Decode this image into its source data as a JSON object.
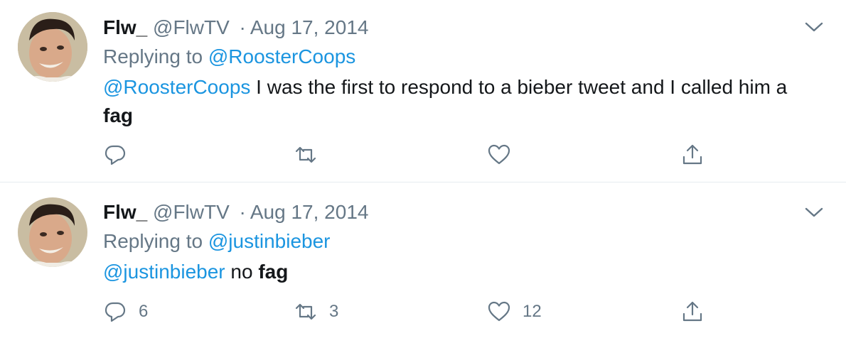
{
  "tweets": [
    {
      "display_name": "Flw_",
      "handle": "@FlwTV",
      "separator": "·",
      "date": "Aug 17, 2014",
      "replying_prefix": "Replying to",
      "replying_to": "@RoosterCoops",
      "text_mention": "@RoosterCoops",
      "text_body": " I was the first to respond to a bieber tweet and I called him a ",
      "text_bold": "fag",
      "counts": {
        "reply": "",
        "retweet": "",
        "like": ""
      }
    },
    {
      "display_name": "Flw_",
      "handle": "@FlwTV",
      "separator": "·",
      "date": "Aug 17, 2014",
      "replying_prefix": "Replying to",
      "replying_to": "@justinbieber",
      "text_mention": "@justinbieber",
      "text_body": " no ",
      "text_bold": "fag",
      "counts": {
        "reply": "6",
        "retweet": "3",
        "like": "12"
      }
    }
  ],
  "icons": {
    "reply": "reply-icon",
    "retweet": "retweet-icon",
    "like": "heart-icon",
    "share": "share-icon",
    "menu": "chevron-down-icon"
  },
  "colors": {
    "link": "#1b95e0",
    "secondary_text": "#657786",
    "primary_text": "#14171a",
    "divider": "#e6ecf0"
  }
}
